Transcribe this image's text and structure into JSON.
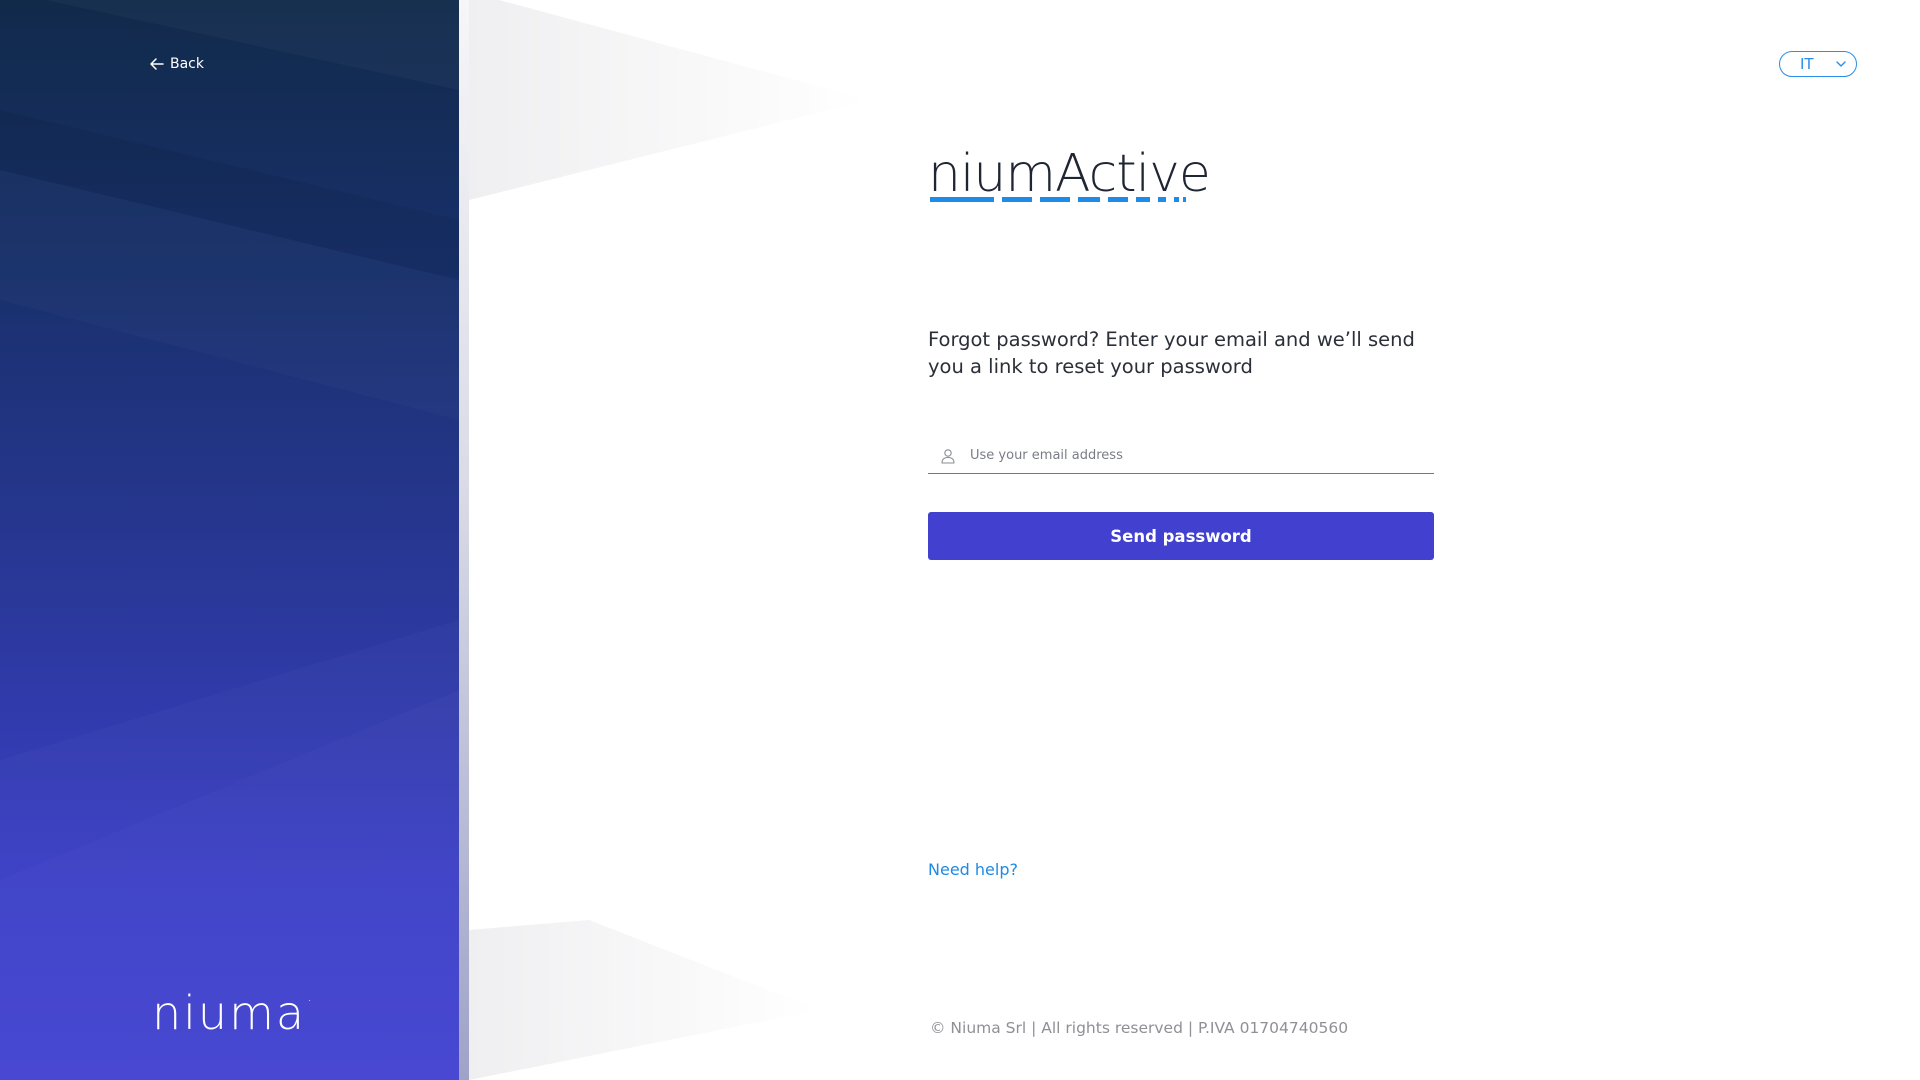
{
  "nav": {
    "back_label": "Back"
  },
  "brand": {
    "company_logo_text": "niuma",
    "product_logo_text": "niumActive"
  },
  "language": {
    "selected": "IT"
  },
  "form": {
    "heading": "Forgot password? Enter your email and we’ll send you a link to reset your password",
    "email_placeholder": "Use your email address",
    "email_value": "",
    "submit_label": "Send password"
  },
  "help": {
    "label": "Need help?"
  },
  "footer": {
    "text": "© Niuma Srl | All rights reserved | P.IVA 01704740560"
  },
  "colors": {
    "primary_button": "#4140cf",
    "link": "#1d8ae4",
    "logo_accent": "#1f8be8",
    "panel_top": "#112a4a",
    "panel_bottom": "#4141d2"
  },
  "icons": {
    "back": "arrow-left-icon",
    "language": "chevron-down-icon",
    "email": "user-icon"
  }
}
